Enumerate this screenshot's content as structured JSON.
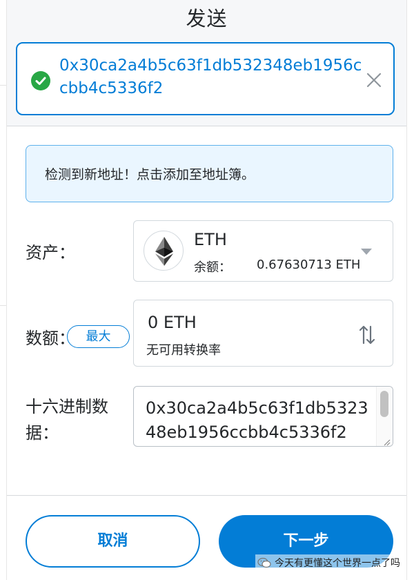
{
  "header": {
    "title": "发送",
    "recipient_address": "0x30ca2a4b5c63f1db532348eb1956ccbb4c5336f2"
  },
  "notice": {
    "text": "检测到新地址！点击添加至地址簿。"
  },
  "asset": {
    "label": "资产：",
    "name": "ETH",
    "balance_label": "余额：",
    "balance_value": "0.67630713 ETH"
  },
  "amount": {
    "label": "数额：",
    "max_label": "最大",
    "value": "0 ETH",
    "rate_text": "无可用转换率"
  },
  "hex_data": {
    "label": "十六进制数据：",
    "value": "0x30ca2a4b5c63f1db532348eb1956ccbb4c5336f2"
  },
  "footer": {
    "cancel_label": "取消",
    "next_label": "下一步"
  },
  "watermark": {
    "text": "今天有更懂这个世界一点了吗"
  },
  "colors": {
    "accent": "#037dd6",
    "success": "#28a745",
    "notice_bg": "#eaf6ff"
  },
  "icons": [
    "check-circle-icon",
    "close-icon",
    "ethereum-icon",
    "caret-down-icon",
    "swap-vertical-icon",
    "wechat-icon"
  ]
}
